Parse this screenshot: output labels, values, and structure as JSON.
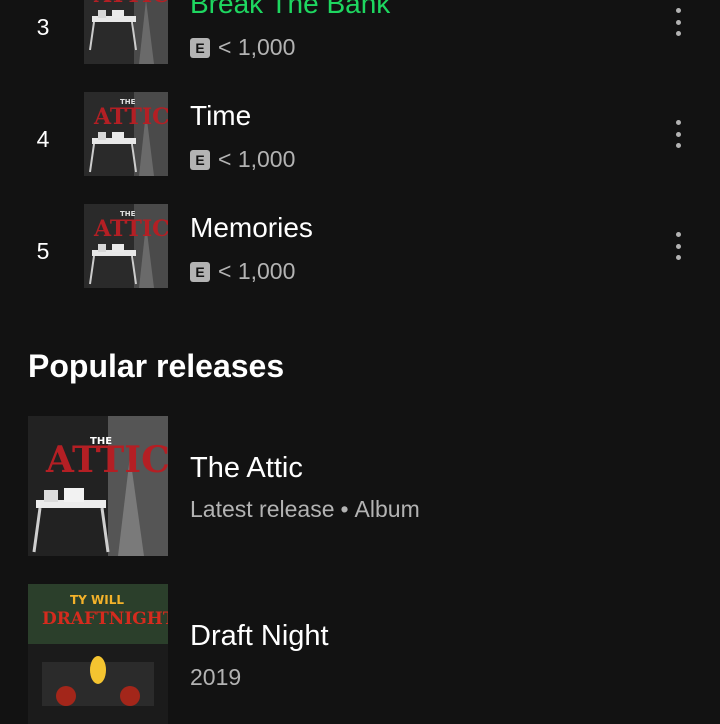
{
  "tracks": [
    {
      "rank": "3",
      "title": "Break The Bank",
      "explicit": "E",
      "plays": "< 1,000",
      "active": true
    },
    {
      "rank": "4",
      "title": "Time",
      "explicit": "E",
      "plays": "< 1,000",
      "active": false
    },
    {
      "rank": "5",
      "title": "Memories",
      "explicit": "E",
      "plays": "< 1,000",
      "active": false
    }
  ],
  "section": {
    "title": "Popular releases"
  },
  "releases": [
    {
      "title": "The Attic",
      "sub_a": "Latest release",
      "separator": "•",
      "sub_b": "Album"
    },
    {
      "title": "Draft Night",
      "sub_a": "2019"
    }
  ],
  "art": {
    "attic_word": "ATTIC",
    "attic_the": "THE",
    "draft_top": "TY WILL",
    "draft_word": "DRAFTNIGHT"
  },
  "colors": {
    "accent": "#1ed760",
    "background": "#121212",
    "secondary_text": "#b3b3b3"
  }
}
